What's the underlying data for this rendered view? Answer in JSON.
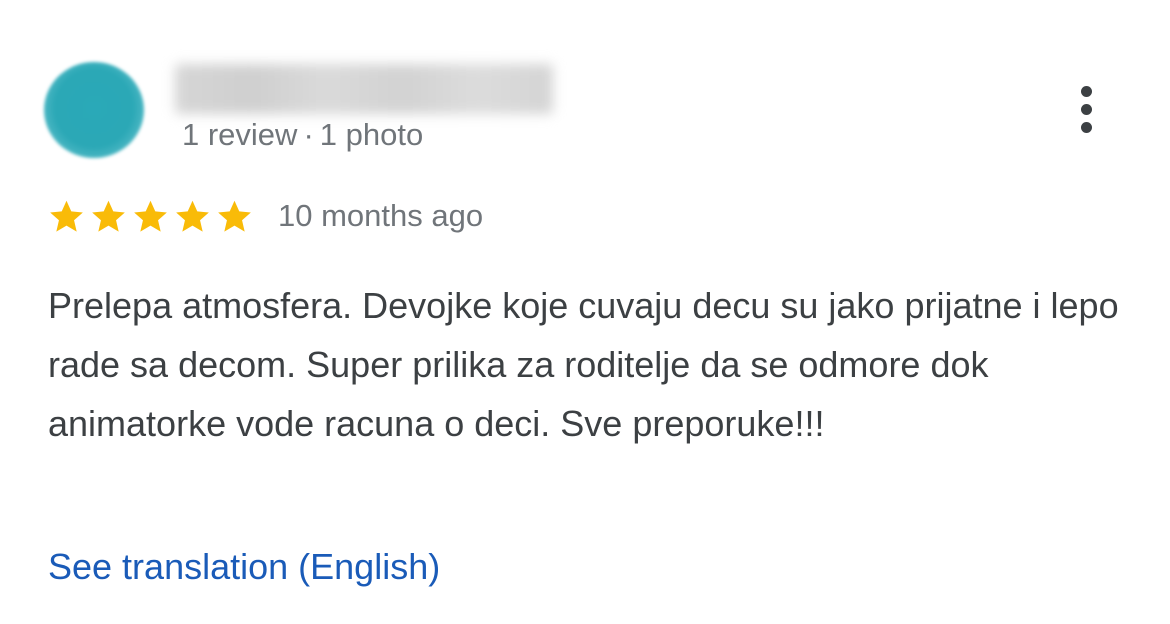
{
  "reviewer": {
    "avatar_color": "#2aa9b8",
    "meta_reviews": "1 review",
    "meta_separator": "·",
    "meta_photos": "1 photo"
  },
  "menu": {
    "icon": "more-vertical-icon"
  },
  "rating": {
    "stars": 5,
    "max_stars": 5,
    "star_color": "#f9bb08",
    "time": "10 months ago"
  },
  "review": {
    "text": "Prelepa atmosfera. Devojke koje cuvaju decu su jako prijatne i lepo rade sa decom. Super prilika za roditelje da se odmore dok animatorke vode racuna o deci. Sve preporuke!!!"
  },
  "actions": {
    "translate_label": "See translation (English)",
    "link_color": "#1a5bb8"
  }
}
